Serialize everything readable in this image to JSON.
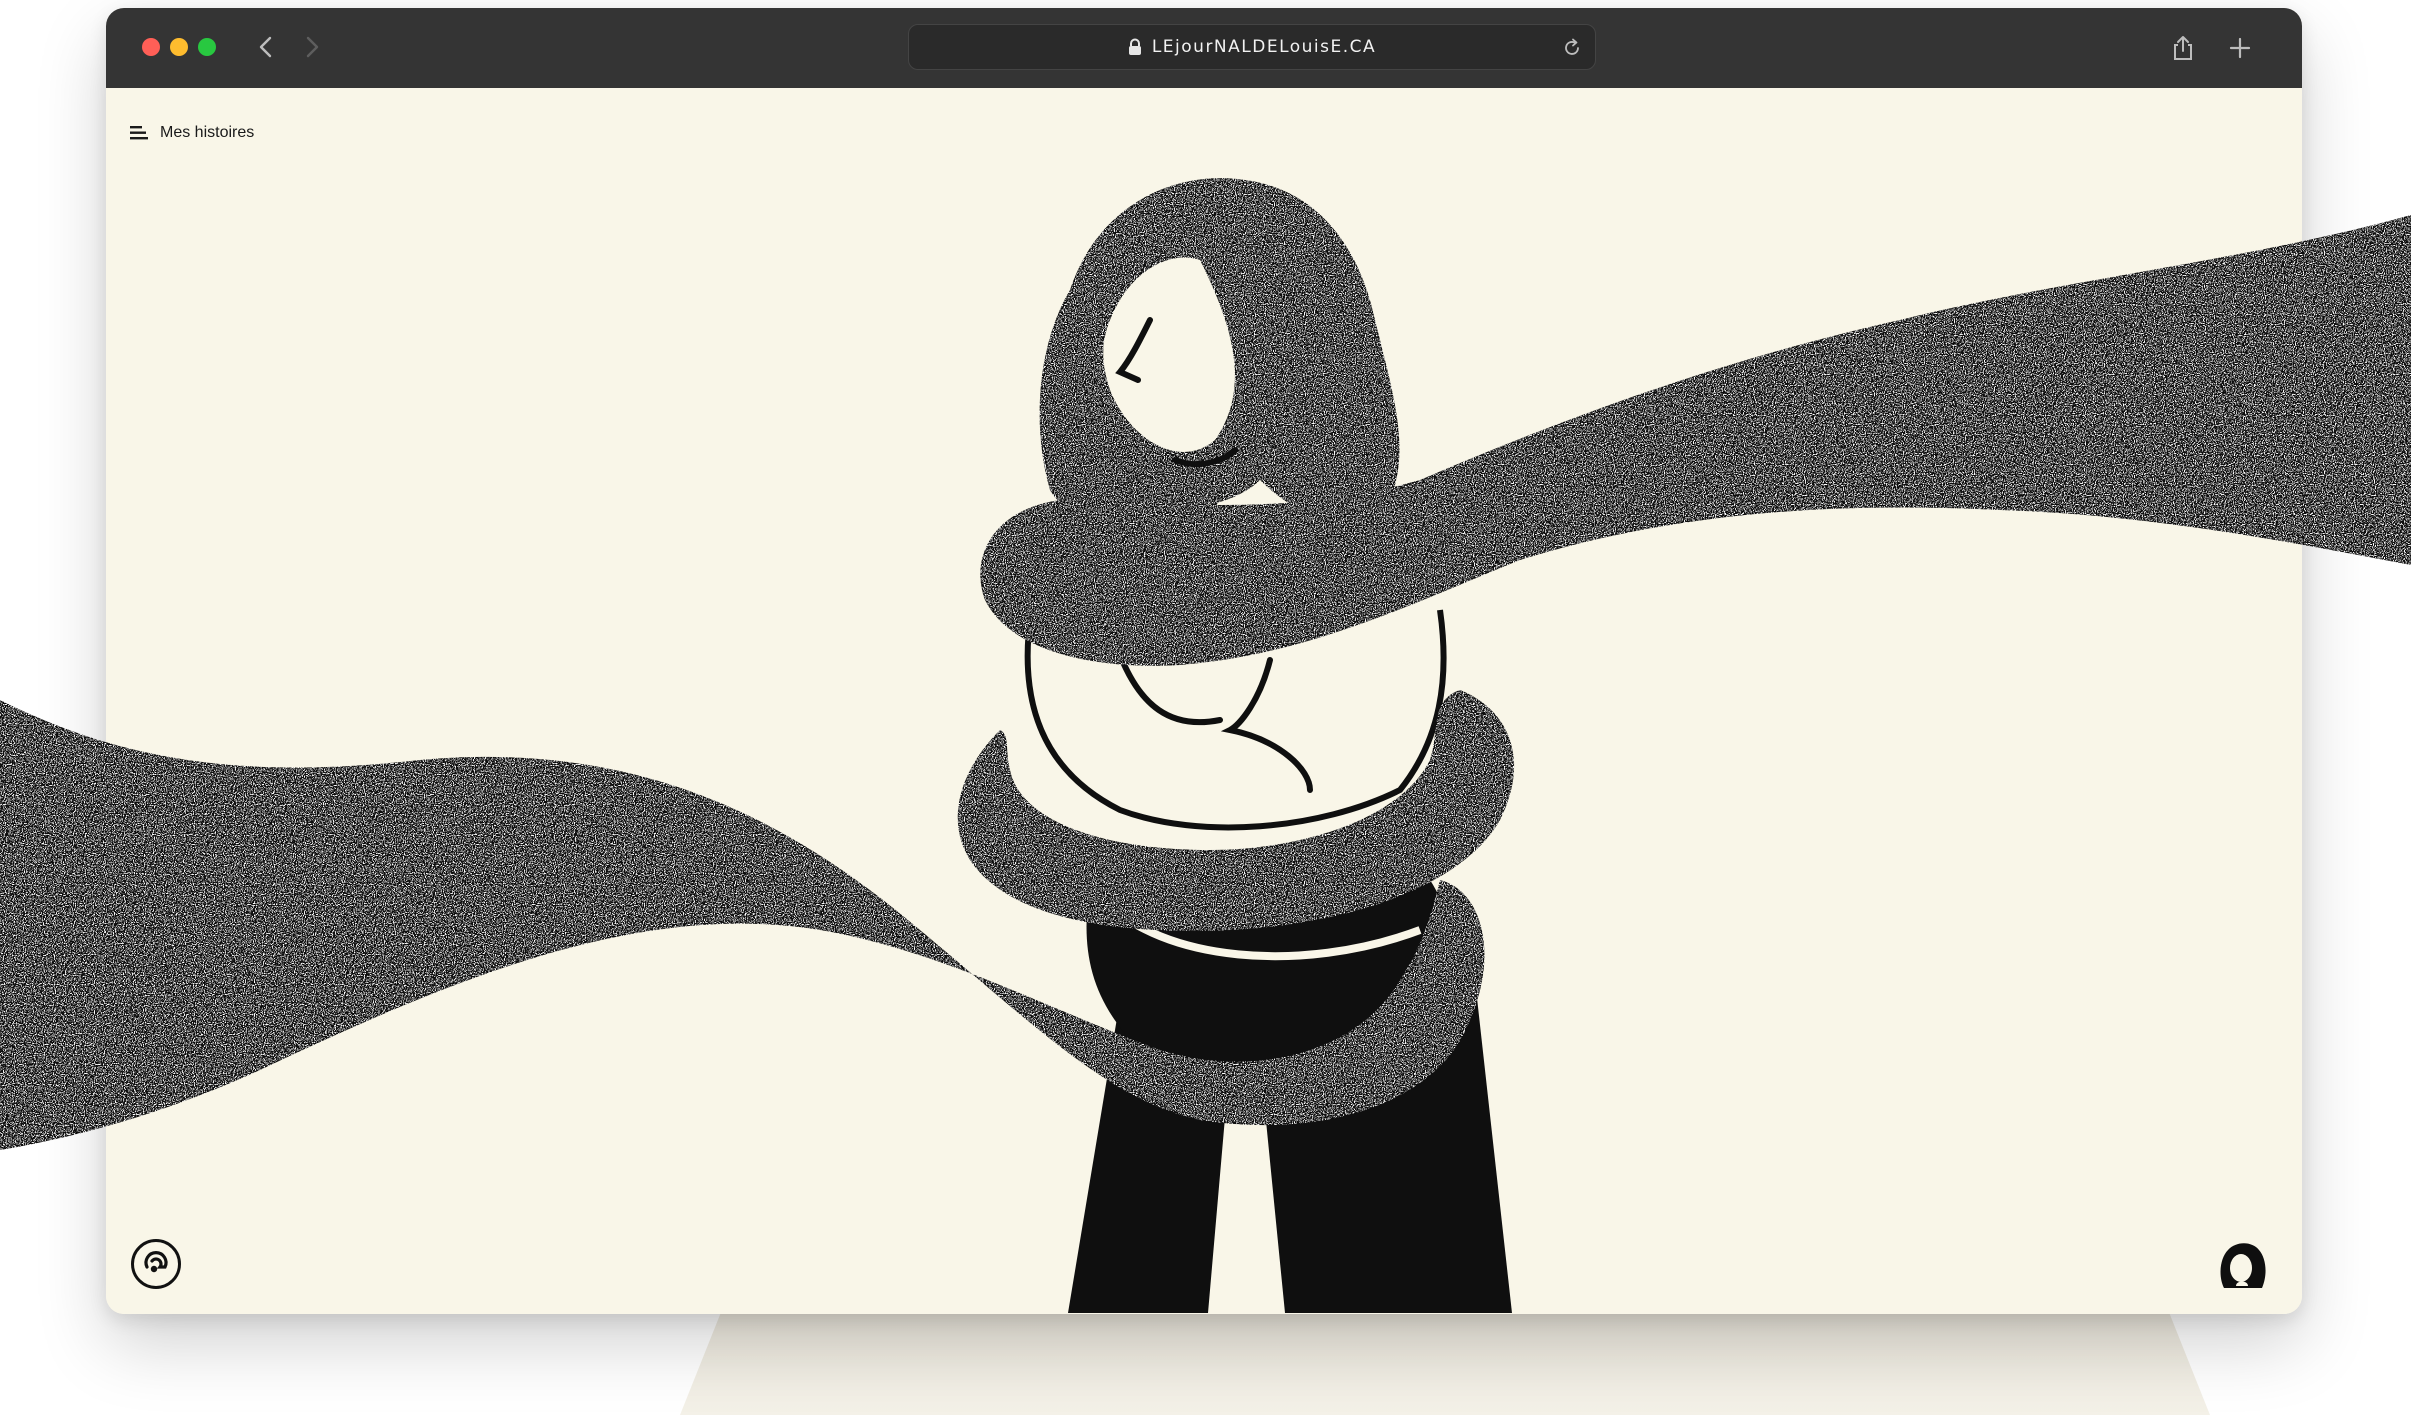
{
  "browser": {
    "url": "LEjourNALDELouisE.CA"
  },
  "page": {
    "menu_label": "Mes histoires"
  },
  "colors": {
    "background": "#f9f6e8",
    "titlebar": "#343434",
    "ink": "#0f0f0f",
    "traffic_red": "#ff5f57",
    "traffic_yellow": "#febc2e",
    "traffic_green": "#28c840"
  },
  "icons": {
    "menu": "hamburger-icon",
    "lock": "lock-icon",
    "reload": "reload-icon",
    "share": "share-icon",
    "new_tab": "plus-icon",
    "sound": "sound-icon",
    "avatar": "avatar-icon"
  }
}
